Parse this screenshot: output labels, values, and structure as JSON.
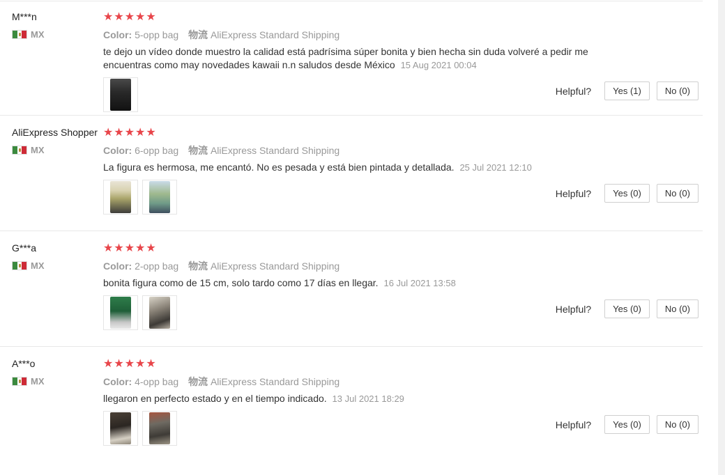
{
  "reviews": [
    {
      "user": "M***n",
      "country": "MX",
      "stars": "★★★★★",
      "color_label": "Color:",
      "color_value": "5-opp bag",
      "ship_label": "物流",
      "ship_value": "AliExpress Standard Shipping",
      "text": "te dejo un vídeo donde muestro la calidad está padrísima súper bonita y bien hecha sin duda volveré a pedir me encuentras como may novedades kawaii n.n saludos desde México",
      "date": "15 Aug 2021 00:04",
      "helpful_label": "Helpful?",
      "yes_label": "Yes (1)",
      "no_label": "No (0)"
    },
    {
      "user": "AliExpress Shopper",
      "country": "MX",
      "stars": "★★★★★",
      "color_label": "Color:",
      "color_value": "6-opp bag",
      "ship_label": "物流",
      "ship_value": "AliExpress Standard Shipping",
      "text": "La figura es hermosa, me encantó. No es pesada y está bien pintada y detallada.",
      "date": "25 Jul 2021 12:10",
      "helpful_label": "Helpful?",
      "yes_label": "Yes (0)",
      "no_label": "No (0)"
    },
    {
      "user": "G***a",
      "country": "MX",
      "stars": "★★★★★",
      "color_label": "Color:",
      "color_value": "2-opp bag",
      "ship_label": "物流",
      "ship_value": "AliExpress Standard Shipping",
      "text": "bonita figura como de 15 cm, solo tardo como 17 días en llegar.",
      "date": "16 Jul 2021 13:58",
      "helpful_label": "Helpful?",
      "yes_label": "Yes (0)",
      "no_label": "No (0)"
    },
    {
      "user": "A***o",
      "country": "MX",
      "stars": "★★★★★",
      "color_label": "Color:",
      "color_value": "4-opp bag",
      "ship_label": "物流",
      "ship_value": "AliExpress Standard Shipping",
      "text": "llegaron en perfecto estado y en el tiempo indicado.",
      "date": "13 Jul 2021 18:29",
      "helpful_label": "Helpful?",
      "yes_label": "Yes (0)",
      "no_label": "No (0)"
    }
  ],
  "colors": {
    "star": "#e8454a",
    "muted": "#999999"
  },
  "icons": {
    "flag": "mexico-flag-icon",
    "star": "star-icon"
  }
}
